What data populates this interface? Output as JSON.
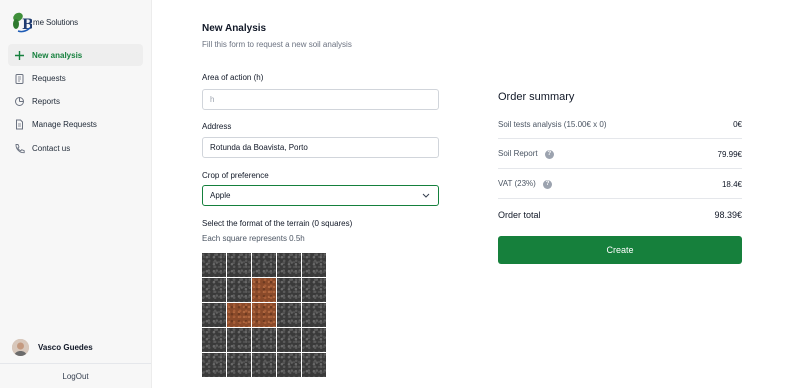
{
  "sidebar": {
    "logo_text": "me Solutions",
    "items": [
      {
        "label": "New analysis",
        "icon": "plus-icon",
        "active": true
      },
      {
        "label": "Requests",
        "icon": "clipboard-icon"
      },
      {
        "label": "Reports",
        "icon": "chart-icon"
      },
      {
        "label": "Manage Requests",
        "icon": "document-icon"
      },
      {
        "label": "Contact us",
        "icon": "phone-icon"
      }
    ],
    "user_name": "Vasco Guedes",
    "logout_label": "LogOut"
  },
  "form": {
    "title": "New Analysis",
    "subtitle": "Fill this form to request a new soil analysis",
    "area_label": "Area of action (h)",
    "area_placeholder": "h",
    "address_label": "Address",
    "address_value": "Rotunda da Boavista, Porto",
    "crop_label": "Crop of preference",
    "crop_value": "Apple",
    "terrain_label": "Select the format of the terrain (0 squares)",
    "terrain_note": "Each square represents 0.5h",
    "terrain_selected": [
      [
        1,
        2
      ],
      [
        2,
        1
      ],
      [
        2,
        2
      ]
    ]
  },
  "summary": {
    "title": "Order summary",
    "rows": [
      {
        "label": "Soil tests analysis (15.00€ x 0)",
        "value": "0€"
      },
      {
        "label": "Soil Report",
        "value": "79.99€"
      },
      {
        "label": "VAT (23%)",
        "value": "18.4€"
      }
    ],
    "total_label": "Order total",
    "total_value": "98.39€",
    "create_label": "Create"
  },
  "colors": {
    "accent": "#16803c",
    "soil_selected": "#8a4a2a"
  }
}
